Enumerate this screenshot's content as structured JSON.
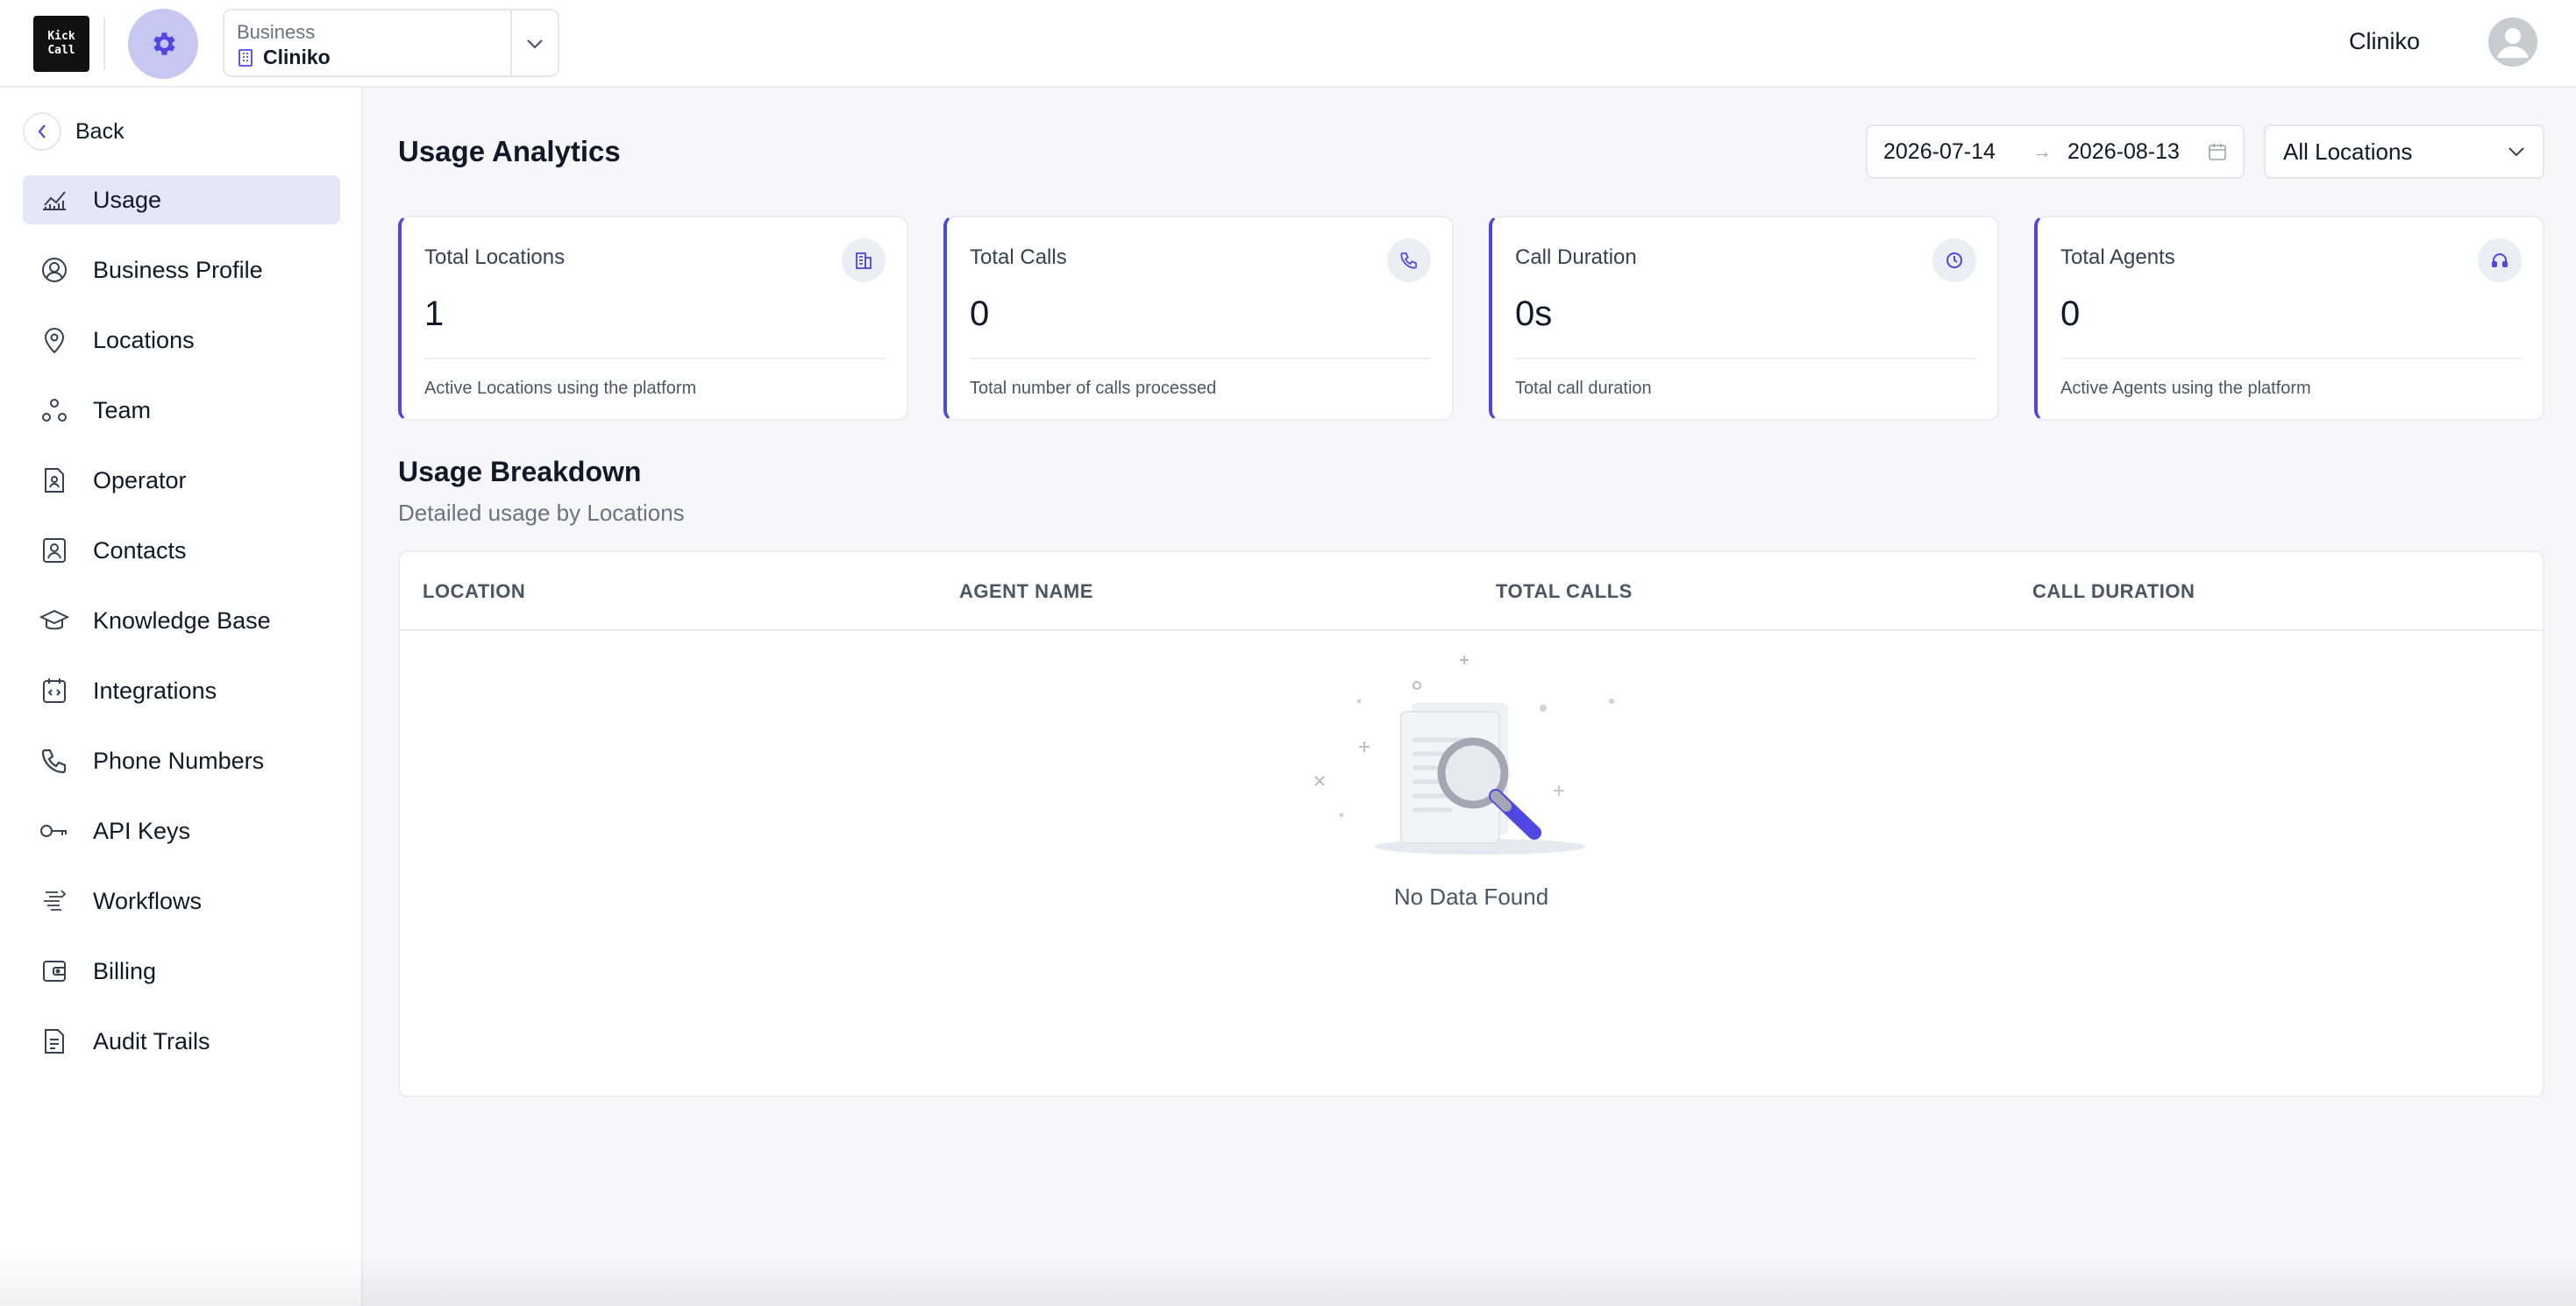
{
  "brand": {
    "logo_line1": "Kick",
    "logo_line2": "Call"
  },
  "business": {
    "label": "Business",
    "value": "Cliniko"
  },
  "user": {
    "name": "Cliniko"
  },
  "sidebar": {
    "back_label": "Back",
    "items": [
      {
        "label": "Usage",
        "icon": "chart-line-icon",
        "active": true
      },
      {
        "label": "Business Profile",
        "icon": "user-circle-icon"
      },
      {
        "label": "Locations",
        "icon": "map-pin-icon"
      },
      {
        "label": "Team",
        "icon": "team-icon"
      },
      {
        "label": "Operator",
        "icon": "operator-icon"
      },
      {
        "label": "Contacts",
        "icon": "contacts-icon"
      },
      {
        "label": "Knowledge Base",
        "icon": "graduation-cap-icon"
      },
      {
        "label": "Integrations",
        "icon": "integrations-icon"
      },
      {
        "label": "Phone Numbers",
        "icon": "phone-icon"
      },
      {
        "label": "API Keys",
        "icon": "key-icon"
      },
      {
        "label": "Workflows",
        "icon": "workflow-icon"
      },
      {
        "label": "Billing",
        "icon": "wallet-icon"
      },
      {
        "label": "Audit Trails",
        "icon": "document-icon"
      }
    ]
  },
  "main": {
    "title": "Usage Analytics",
    "date_start": "2026-07-14",
    "date_arrow": "→",
    "date_end": "2026-08-13",
    "location_filter": "All Locations",
    "cards": [
      {
        "title": "Total Locations",
        "value": "1",
        "footer": "Active Locations using the platform",
        "icon": "building-icon"
      },
      {
        "title": "Total Calls",
        "value": "0",
        "footer": "Total number of calls processed",
        "icon": "phone-icon"
      },
      {
        "title": "Call Duration",
        "value": "0s",
        "footer": "Total call duration",
        "icon": "clock-icon"
      },
      {
        "title": "Total Agents",
        "value": "0",
        "footer": "Active Agents using the platform",
        "icon": "headset-icon"
      }
    ],
    "breakdown": {
      "title": "Usage Breakdown",
      "subtitle": "Detailed usage by Locations",
      "columns": [
        "LOCATION",
        "AGENT NAME",
        "TOTAL CALLS",
        "CALL DURATION"
      ],
      "empty_text": "No Data Found"
    }
  },
  "colors": {
    "accent": "#4f46e5",
    "active_bg": "#e6e7f6",
    "gear_bg": "#c7c8f2"
  }
}
